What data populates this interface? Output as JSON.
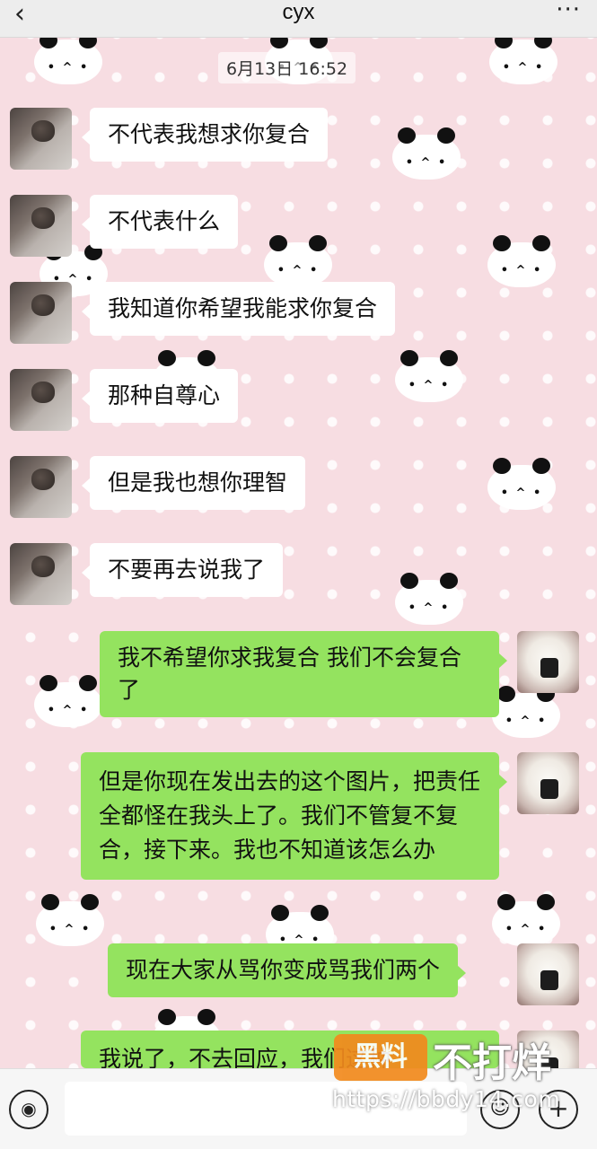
{
  "header": {
    "title": "cyx",
    "back_icon": "chevron-left-icon",
    "more_icon": "more-dots-icon",
    "back_glyph": "‹",
    "more_glyph": "···"
  },
  "timestamp": "6月13日 16:52",
  "messages": [
    {
      "side": "in",
      "text": "不代表我想求你复合"
    },
    {
      "side": "in",
      "text": "不代表什么"
    },
    {
      "side": "in",
      "text": "我知道你希望我能求你复合"
    },
    {
      "side": "in",
      "text": "那种自尊心"
    },
    {
      "side": "in",
      "text": "但是我也想你理智"
    },
    {
      "side": "in",
      "text": "不要再去说我了"
    },
    {
      "side": "out",
      "text": "我不希望你求我复合 我们不会复合了"
    },
    {
      "side": "out",
      "text": "但是你现在发出去的这个图片，把责任全都怪在我头上了。我们不管复不复合，接下来。我也不知道该怎么办"
    },
    {
      "side": "out",
      "text": "现在大家从骂你变成骂我们两个"
    },
    {
      "side": "out",
      "text": "我说了，不去回应，我们这种"
    }
  ],
  "input_bar": {
    "voice_icon": "voice-icon",
    "emoji_icon": "emoji-icon",
    "plus_icon": "plus-icon",
    "voice_glyph": "◉",
    "emoji_glyph": "☺",
    "plus_glyph": "+",
    "input_value": ""
  },
  "watermark": {
    "logo_text": "黑料",
    "name": "不打烊",
    "url": "https://bbdy14.com"
  },
  "colors": {
    "incoming_bubble": "#ffffff",
    "outgoing_bubble": "#94e35f",
    "background": "#f7dde2",
    "header": "#ededed"
  }
}
